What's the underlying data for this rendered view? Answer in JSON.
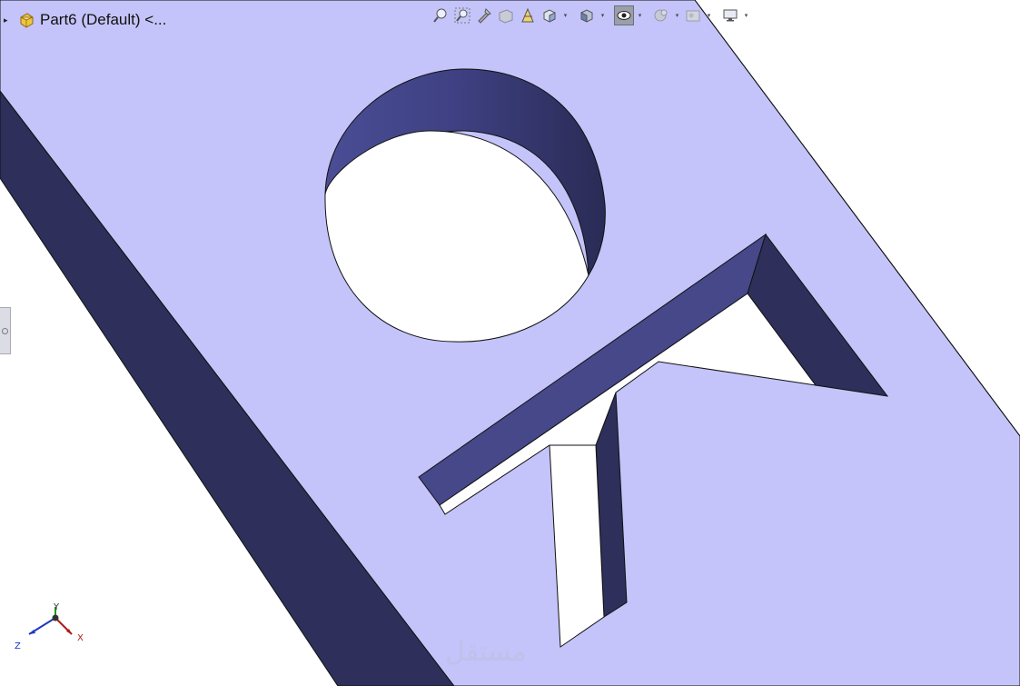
{
  "tree": {
    "part_label": "Part6 (Default) <...",
    "expand_icon": "expand-arrow-icon",
    "part_icon": "part-icon"
  },
  "toolbar": {
    "buttons": [
      {
        "icon": "zoom-to-fit-icon",
        "active": false
      },
      {
        "icon": "zoom-to-area-icon",
        "active": false
      },
      {
        "icon": "previous-view-icon",
        "active": false
      },
      {
        "icon": "section-view-icon",
        "active": false
      },
      {
        "icon": "dynamic-annotation-views-icon",
        "active": false
      },
      {
        "icon": "view-orientation-icon",
        "active": false,
        "dropdown": true
      },
      {
        "icon": "display-style-icon",
        "active": false,
        "dropdown": true
      },
      {
        "icon": "hide-show-items-icon",
        "active": true,
        "dropdown": true
      },
      {
        "icon": "edit-appearance-icon",
        "active": false,
        "dropdown": true
      },
      {
        "icon": "apply-scene-icon",
        "active": false,
        "dropdown": true
      },
      {
        "icon": "view-settings-icon",
        "active": false,
        "dropdown": true
      }
    ]
  },
  "triad": {
    "x_label": "X",
    "y_label": "Y",
    "z_label": "Z"
  },
  "colors": {
    "top_face": "#c4c4fa",
    "side_dark": "#2e2f5a",
    "side_mid": "#46488a",
    "edge": "#111111",
    "background": "#ffffff"
  },
  "watermark": "مستقل"
}
